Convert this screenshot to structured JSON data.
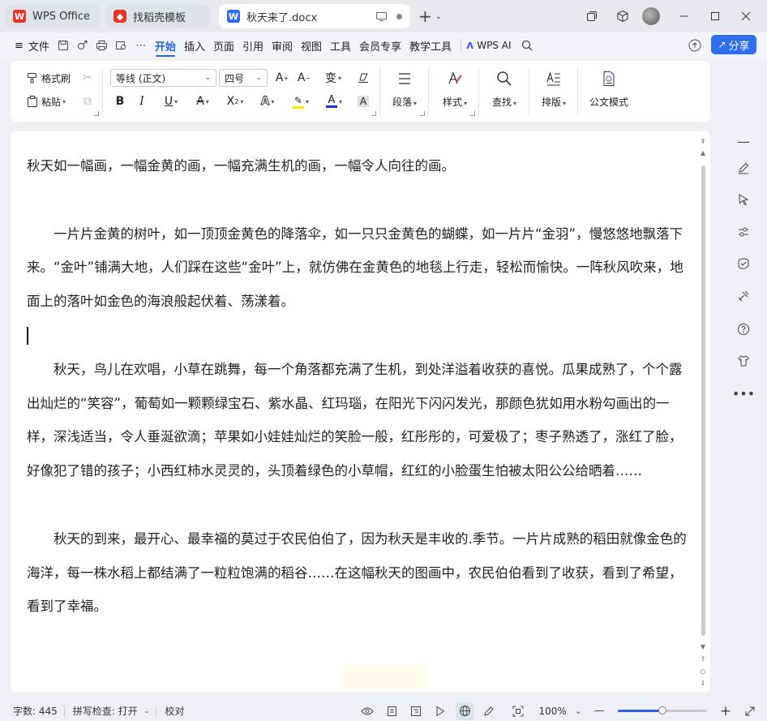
{
  "titlebar": {
    "app_tab": "WPS Office",
    "template_tab": "找稻壳模板",
    "doc_tab": "秋天来了.docx"
  },
  "menubar": {
    "file": "文件",
    "tabs": [
      "开始",
      "插入",
      "页面",
      "引用",
      "审阅",
      "视图",
      "工具",
      "会员专享",
      "教学工具"
    ],
    "active_tab": "开始",
    "wps_ai": "WPS AI",
    "share": "分享"
  },
  "ribbon": {
    "format_painter": "格式刷",
    "paste": "粘贴",
    "font_name": "等线 (正文)",
    "font_size": "四号",
    "paragraph": "段落",
    "styles": "样式",
    "find": "查找",
    "layout": "排版",
    "official_mode": "公文模式"
  },
  "document": {
    "paragraphs": [
      "秋天如一幅画，一幅金黄的画，一幅充满生机的画，一幅令人向往的画。",
      "",
      "一片片金黄的树叶，如一顶顶金黄色的降落伞，如一只只金黄色的蝴蝶，如一片片“金羽”，慢悠悠地飘落下来。“金叶”铺满大地，人们踩在这些“金叶”上，就仿佛在金黄色的地毯上行走，轻松而愉快。一阵秋风吹来，地面上的落叶如金色的海浪般起伏着、荡漾着。",
      "",
      "秋天，鸟儿在欢唱，小草在跳舞，每一个角落都充满了生机，到处洋溢着收获的喜悦。瓜果成熟了，个个露出灿烂的“笑容”，葡萄如一颗颗绿宝石、紫水晶、红玛瑙，在阳光下闪闪发光，那颜色犹如用水粉勾画出的一样，深浅适当，令人垂涎欲滴；苹果如小娃娃灿烂的笑脸一般，红彤彤的，可爱极了；枣子熟透了，涨红了脸，好像犯了错的孩子；小西红柿水灵灵的，头顶着绿色的小草帽，红红的小脸蛋生怕被太阳公公给晒着……",
      "",
      "秋天的到来，最开心、最幸福的莫过于农民伯伯了，因为秋天是丰收的.季节。一片片成熟的稻田就像金色的海洋，每一株水稻上都结满了一粒粒饱满的稻谷……在这幅秋天的图画中，农民伯伯看到了收获，看到了希望，看到了幸福。"
    ]
  },
  "status": {
    "word_count": "字数: 445",
    "spell_check": "拼写检查: 打开",
    "proofread": "校对",
    "zoom": "100%",
    "zoom_level": 0.5
  },
  "colors": {
    "accent": "#2a62e6",
    "share_bg": "#2f6ef0",
    "wps_red": "#e8352b",
    "doc_blue": "#2f6ef0"
  }
}
